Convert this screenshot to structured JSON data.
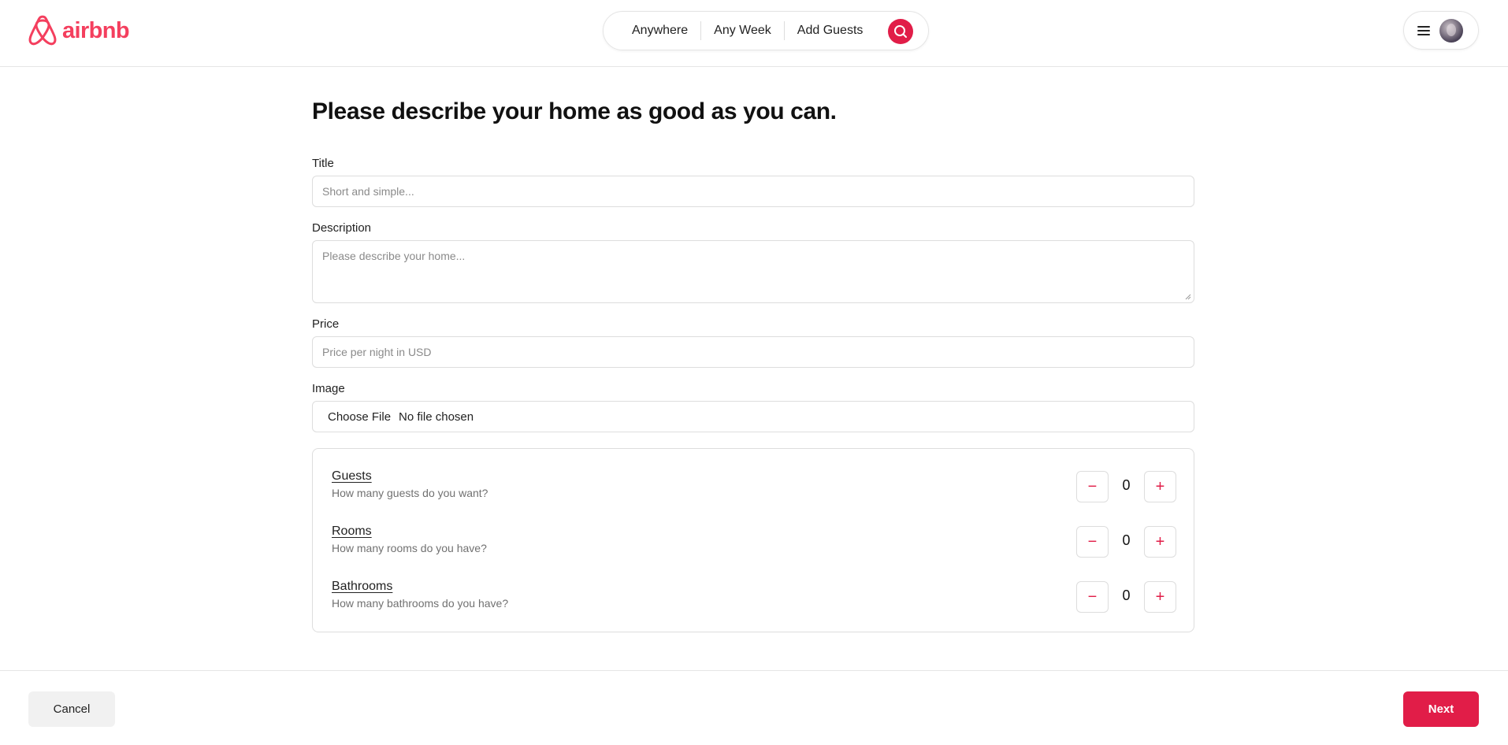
{
  "header": {
    "brand": "airbnb",
    "search": {
      "location": "Anywhere",
      "dates": "Any Week",
      "guests": "Add Guests",
      "search_icon": "search-icon"
    },
    "menu_icon": "hamburger-menu-icon"
  },
  "form": {
    "heading": "Please describe your home as good as you can.",
    "title": {
      "label": "Title",
      "placeholder": "Short and simple..."
    },
    "description": {
      "label": "Description",
      "placeholder": "Please describe your home..."
    },
    "price": {
      "label": "Price",
      "placeholder": "Price per night in USD"
    },
    "image": {
      "label": "Image",
      "button": "Choose File",
      "status": "No file chosen"
    },
    "counters": [
      {
        "title": "Guests",
        "subtitle": "How many guests do you want?",
        "value": "0"
      },
      {
        "title": "Rooms",
        "subtitle": "How many rooms do you have?",
        "value": "0"
      },
      {
        "title": "Bathrooms",
        "subtitle": "How many bathrooms do you have?",
        "value": "0"
      }
    ],
    "minus_symbol": "−",
    "plus_symbol": "+"
  },
  "footer": {
    "cancel": "Cancel",
    "next": "Next"
  },
  "colors": {
    "brand": "#f43f5e",
    "accent": "#e11d48"
  }
}
